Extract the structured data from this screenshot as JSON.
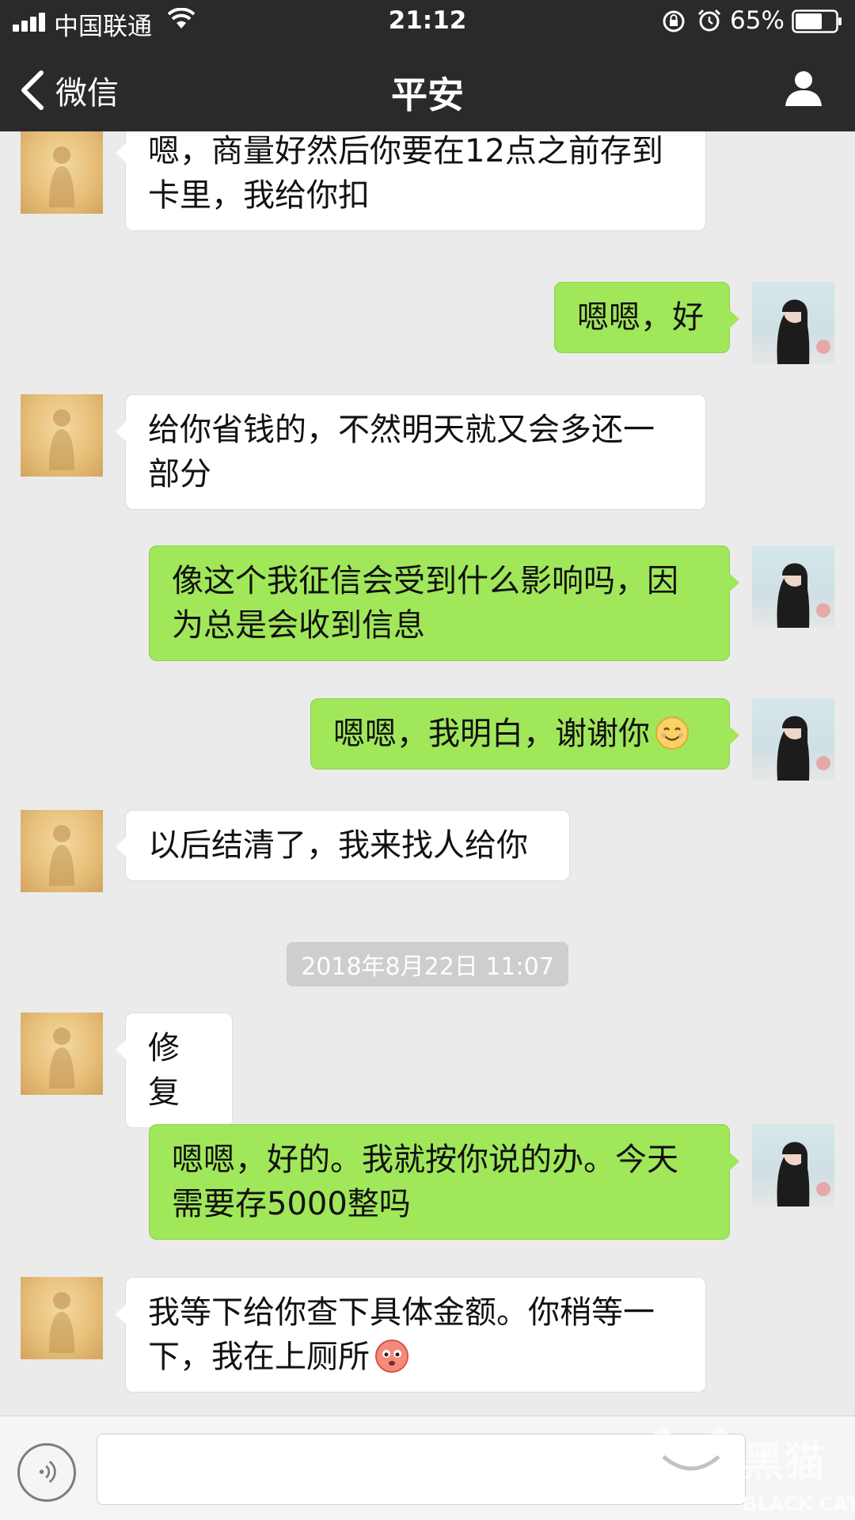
{
  "status_bar": {
    "carrier": "中国联通",
    "time": "21:12",
    "battery_percent": "65%",
    "signal_bars": 4,
    "battery_level": 0.65
  },
  "nav": {
    "back_label": "微信",
    "title": "平安",
    "icons": [
      "chevron-left-icon",
      "contact-icon"
    ]
  },
  "messages": [
    {
      "side": "in",
      "text": "嗯，商量好然后你要在12点之前存到卡里，我给你扣"
    },
    {
      "side": "out",
      "text": "嗯嗯，好"
    },
    {
      "side": "in",
      "text": "给你省钱的，不然明天就又会多还一部分"
    },
    {
      "side": "out",
      "text": "像这个我征信会受到什么影响吗，因为总是会收到信息"
    },
    {
      "side": "out",
      "text": "嗯嗯，我明白，谢谢你",
      "emoji": "smile-emoji"
    },
    {
      "side": "in",
      "text": "以后结清了，我来找人给你"
    },
    {
      "side": "in",
      "text": "修复"
    },
    {
      "side": "out",
      "text": "嗯嗯，好的。我就按你说的办。今天需要存5000整吗"
    },
    {
      "side": "in",
      "text": "我等下给你查下具体金额。你稍等一下，我在上厕所",
      "emoji": "blush-emoji"
    }
  ],
  "timestamp": "2018年8月22日 11:07",
  "input_bar": {
    "placeholder": "",
    "icons": [
      "voice-icon"
    ]
  },
  "watermark": {
    "text": "BLACK CAT",
    "text_cn": "黑猫"
  },
  "colors": {
    "header_bg": "#2a2a2c",
    "chat_bg": "#ebebeb",
    "bubble_out": "#a0e75a",
    "bubble_in": "#ffffff"
  }
}
